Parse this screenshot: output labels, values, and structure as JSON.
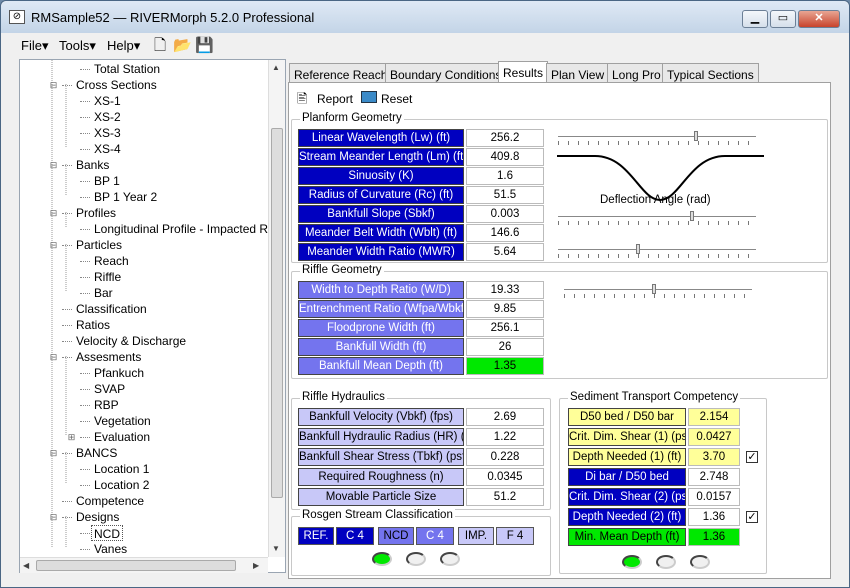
{
  "window": {
    "title": "RMSample52 — RIVERMorph 5.2.0 Professional",
    "icon": "app-logo-icon",
    "controls": [
      "minimize-icon",
      "maximize-icon",
      "close-icon"
    ]
  },
  "menu": {
    "items": [
      "File",
      "Tools",
      "Help"
    ],
    "toolbar_icons": [
      "new-file-icon",
      "open-folder-icon",
      "save-icon"
    ]
  },
  "tree": {
    "items": [
      {
        "label": "Total Station"
      },
      {
        "label": "Cross Sections"
      },
      {
        "label": "XS-1"
      },
      {
        "label": "XS-2"
      },
      {
        "label": "XS-3"
      },
      {
        "label": "XS-4"
      },
      {
        "label": "Banks"
      },
      {
        "label": "BP 1"
      },
      {
        "label": "BP 1 Year 2"
      },
      {
        "label": "Profiles"
      },
      {
        "label": "Longitudinal Profile - Impacted Reach"
      },
      {
        "label": "Particles"
      },
      {
        "label": "Reach"
      },
      {
        "label": "Riffle"
      },
      {
        "label": "Bar"
      },
      {
        "label": "Classification"
      },
      {
        "label": "Ratios"
      },
      {
        "label": "Velocity & Discharge"
      },
      {
        "label": "Assesments"
      },
      {
        "label": "Pfankuch"
      },
      {
        "label": "SVAP"
      },
      {
        "label": "RBP"
      },
      {
        "label": "Vegetation"
      },
      {
        "label": "Evaluation"
      },
      {
        "label": "BANCS"
      },
      {
        "label": "Location 1"
      },
      {
        "label": "Location 2"
      },
      {
        "label": "Competence"
      },
      {
        "label": "Designs"
      },
      {
        "label": "NCD"
      },
      {
        "label": "Vanes"
      }
    ]
  },
  "tabs": [
    "Reference Reach",
    "Boundary Conditions",
    "Results",
    "Plan View",
    "Long Pro",
    "Typical Sections"
  ],
  "active_tab": "Results",
  "actions": {
    "report": "Report",
    "reset": "Reset"
  },
  "planform": {
    "title": "Planform Geometry",
    "rows": [
      {
        "label": "Linear Wavelength (Lw) (ft)",
        "value": "256.2"
      },
      {
        "label": "Stream Meander Length (Lm) (ft)",
        "value": "409.8"
      },
      {
        "label": "Sinuosity (K)",
        "value": "1.6"
      },
      {
        "label": "Radius of Curvature (Rc) (ft)",
        "value": "51.5"
      },
      {
        "label": "Bankfull Slope (Sbkf)",
        "value": "0.003"
      },
      {
        "label": "Meander Belt Width (Wblt) (ft)",
        "value": "146.6"
      },
      {
        "label": "Meander Width Ratio (MWR)",
        "value": "5.64"
      }
    ],
    "deflection_label": "Deflection Angle (rad)"
  },
  "riffle_geometry": {
    "title": "Riffle Geometry",
    "rows": [
      {
        "label": "Width to Depth Ratio (W/D)",
        "value": "19.33"
      },
      {
        "label": "Entrenchment Ratio (Wfpa/Wbkf)",
        "value": "9.85"
      },
      {
        "label": "Floodprone Width (ft)",
        "value": "256.1"
      },
      {
        "label": "Bankfull Width (ft)",
        "value": "26"
      },
      {
        "label": "Bankfull Mean Depth (ft)",
        "value": "1.35"
      }
    ]
  },
  "riffle_hydraulics": {
    "title": "Riffle Hydraulics",
    "rows": [
      {
        "label": "Bankfull Velocity (Vbkf) (fps)",
        "value": "2.69"
      },
      {
        "label": "Bankfull Hydraulic Radius (HR) (ft)",
        "value": "1.22"
      },
      {
        "label": "Bankfull Shear Stress (Tbkf) (psf)",
        "value": "0.228"
      },
      {
        "label": "Required Roughness (n)",
        "value": "0.0345"
      },
      {
        "label": "Movable Particle Size",
        "value": "51.2"
      }
    ]
  },
  "sediment": {
    "title": "Sediment Transport Competency",
    "rows": [
      {
        "label": "D50 bed / D50 bar",
        "value": "2.154"
      },
      {
        "label": "Crit. Dim. Shear (1) (psf)",
        "value": "0.0427"
      },
      {
        "label": "Depth Needed (1) (ft)",
        "value": "3.70",
        "checked": true
      },
      {
        "label": "Di bar / D50 bed",
        "value": "2.748"
      },
      {
        "label": "Crit. Dim. Shear (2) (psf)",
        "value": "0.0157"
      },
      {
        "label": "Depth Needed (2) (ft)",
        "value": "1.36",
        "checked": true
      },
      {
        "label": "Min. Mean Depth (ft)",
        "value": "1.36"
      }
    ]
  },
  "rosgen": {
    "title": "Rosgen Stream Classification",
    "cells": [
      "REF.",
      "C 4",
      "NCD",
      "C 4",
      "IMP.",
      "F 4"
    ]
  },
  "sliders": {
    "lw": 0.7,
    "deflection": 0.68,
    "mwr": 0.4,
    "riffle": 0.48
  },
  "colors": {
    "dark_label": "#0000c0",
    "mid_label": "#7474ee",
    "light_label": "#c8c8f8",
    "highlight_green": "#00e800",
    "highlight_yellow": "#ffff99"
  }
}
